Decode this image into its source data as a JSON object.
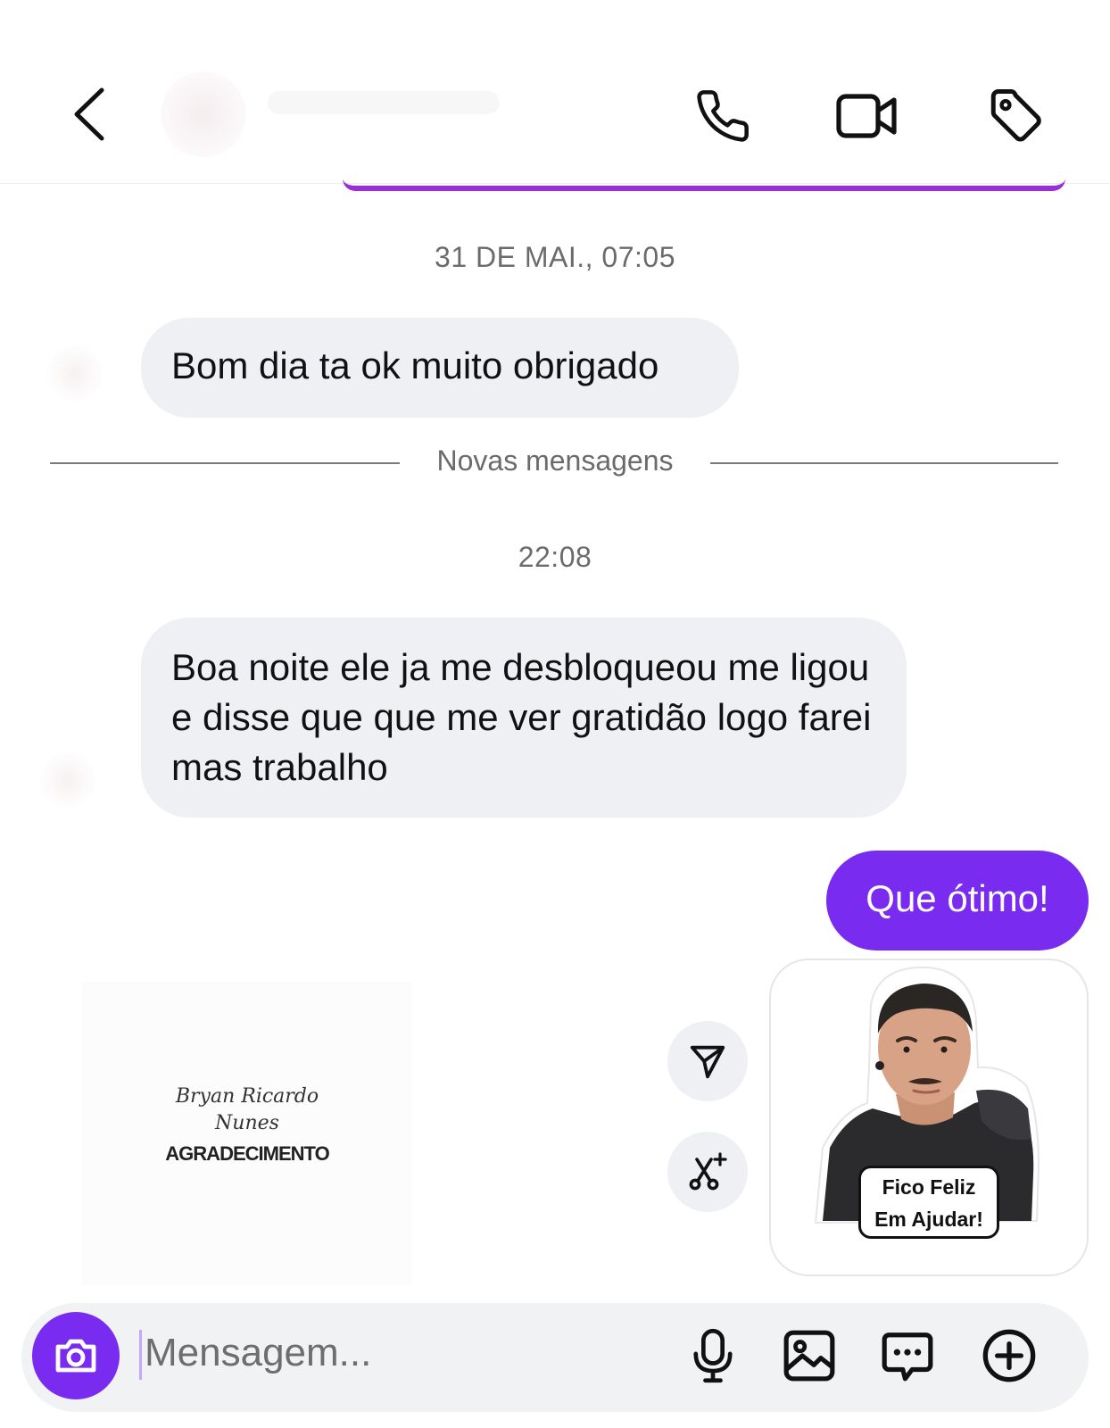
{
  "header": {
    "back_icon": "chevron-left-icon",
    "actions": [
      "phone-icon",
      "video-camera-icon",
      "tag-icon"
    ]
  },
  "accent_color": "#7a2bf0",
  "thread": {
    "timestamp_1": "31 DE MAI., 07:05",
    "message_1": "Bom dia ta ok muito obrigado",
    "divider_label": "Novas mensagens",
    "timestamp_2": "22:08",
    "message_2": "Boa noite  ele ja me desbloqueou  me ligou  e disse que que me ver gratidão logo farei mas trabalho",
    "message_3": "Que ótimo!",
    "card": {
      "signature_line_1": "Bryan Ricardo",
      "signature_line_2": "Nunes",
      "title": "AGRADECIMENTO"
    },
    "sticker": {
      "caption_line_1": "Fico Feliz",
      "caption_line_2": "Em Ajudar!"
    },
    "action_icons": [
      "send-icon",
      "remix-icon"
    ]
  },
  "composer": {
    "placeholder": "Mensagem...",
    "icons": [
      "camera-icon",
      "microphone-icon",
      "image-icon",
      "sticker-icon",
      "plus-circle-icon"
    ]
  }
}
